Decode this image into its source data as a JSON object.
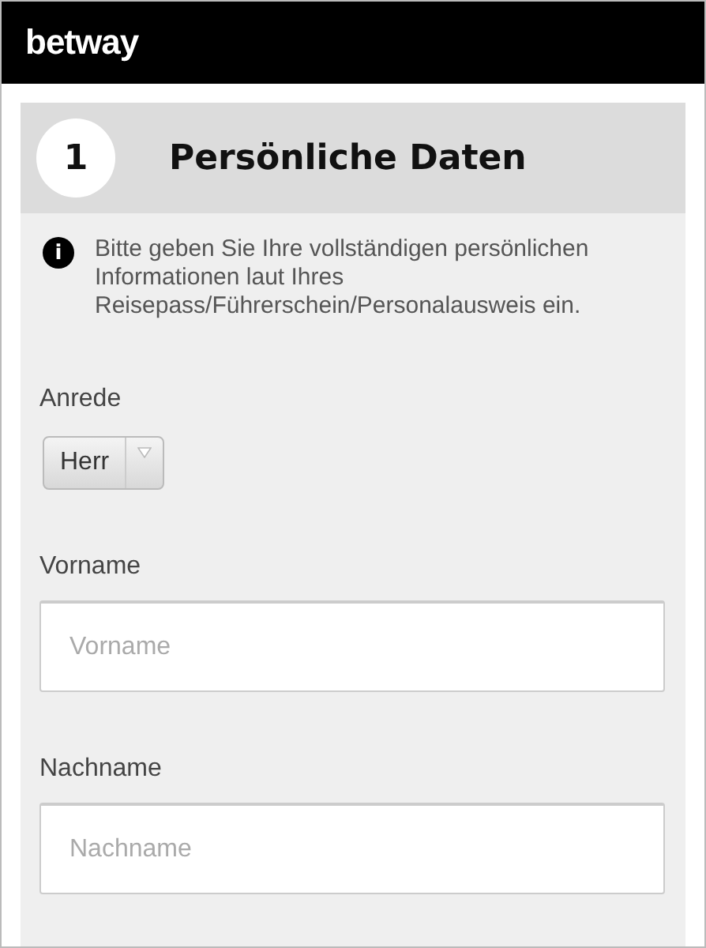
{
  "header": {
    "logo": "betway"
  },
  "step": {
    "number": "1",
    "title": "Persönliche Daten"
  },
  "info": {
    "icon": "i",
    "text": "Bitte geben Sie Ihre vollständigen persönlichen Informationen laut Ihres Reisepass/Führerschein/Personalausweis ein."
  },
  "fields": [
    {
      "kind": "select",
      "label": "Anrede",
      "value": "Herr"
    },
    {
      "kind": "text",
      "label": "Vorname",
      "placeholder": "Vorname"
    },
    {
      "kind": "text",
      "label": "Nachname",
      "placeholder": "Nachname"
    }
  ]
}
